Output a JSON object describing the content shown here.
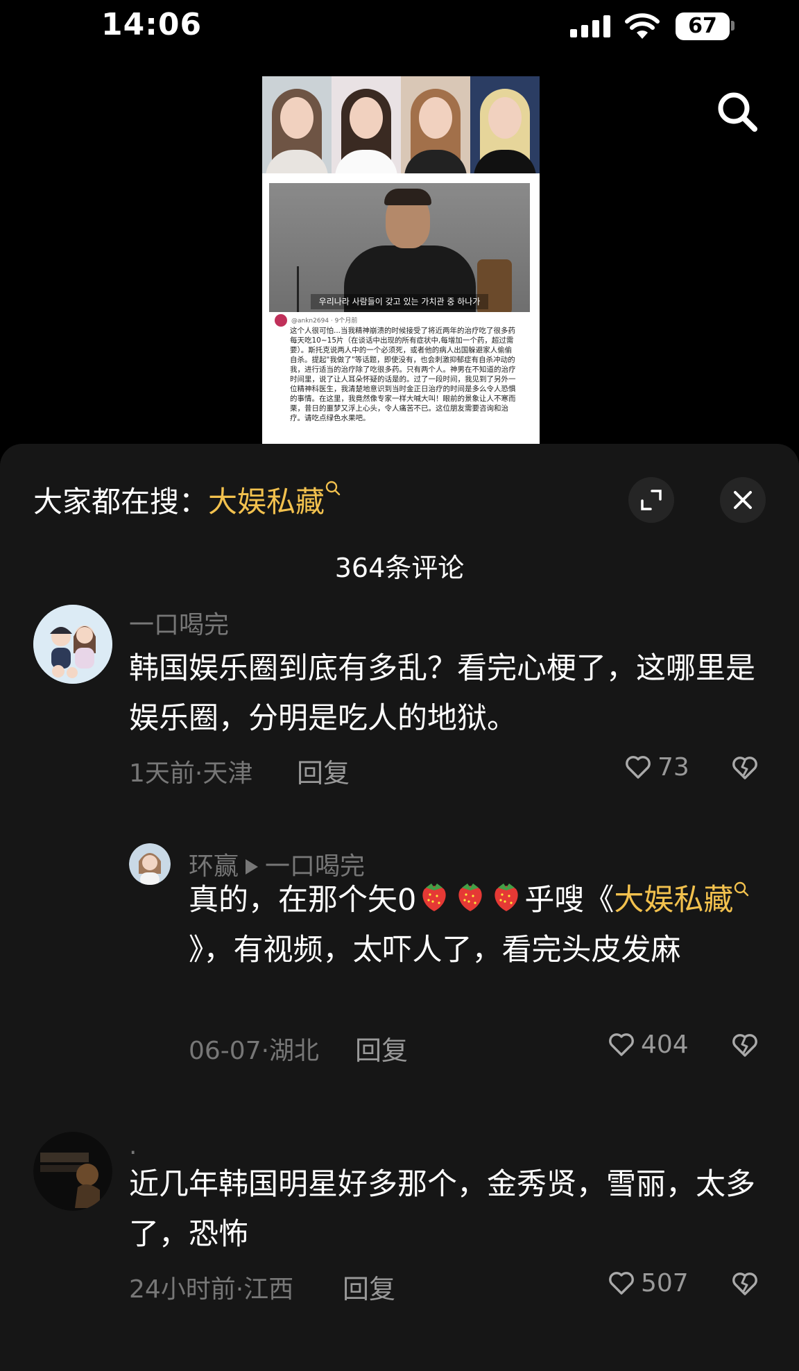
{
  "status_bar": {
    "time": "14:06",
    "battery": "67"
  },
  "video": {
    "caption": "우리나라 사람들이 갖고 있는 가치관 중 하나가",
    "post_meta": "@ankn2694 · 9个月前",
    "post_text": "这个人很可怕...当我精神崩溃的时候接受了将近两年的治疗吃了很多药每天吃10~15片（在谈话中出现的所有症状中,每增加一个药，超过需要）。斯托克说两人中的一个必须死，或者他的病人出国躲避家人偷偷自杀。提起\"我做了\"等话题，即使没有，也会刺激抑郁症有自杀冲动的我，进行适当的治疗除了吃很多药。只有两个人。神男在不知道的治疗时间里，说了让人耳朵怀疑的话是的。过了一段时间，我见到了另外一位精神科医生，我清楚地意识到当时金正日治疗的时间是多么令人恐惧的事情。在这里，我竟然像专家一样大喊大叫！眼前的景象让人不寒而栗，昔日的噩梦又浮上心头，令人痛苦不已。这位朋友需要咨询和治疗。请吃点绿色水果吧。"
  },
  "sheet": {
    "hot_search_prefix": "大家都在搜：",
    "hot_search_term": "大娱私藏",
    "comment_count": "364条评论"
  },
  "comments": [
    {
      "author": "一口喝完",
      "text": "韩国娱乐圈到底有多乱？看完心梗了，这哪里是娱乐圈，分明是吃人的地狱。",
      "time_location": "1天前·天津",
      "reply_label": "回复",
      "likes": "73"
    },
    {
      "author": "环赢",
      "reply_to": "一口喝完",
      "text_part1": "真的，在那个矢0",
      "text_part2": "乎嗖《",
      "text_highlight": "大娱私藏",
      "text_part3": "》，有视频，太吓人了，看完头皮发麻",
      "time_location": "06-07·湖北",
      "reply_label": "回复",
      "likes": "404"
    },
    {
      "author": ".",
      "text": "近几年韩国明星好多那个，金秀贤，雪丽，太多了，恐怖",
      "time_location": "24小时前·江西",
      "reply_label": "回复",
      "likes": "507"
    }
  ]
}
